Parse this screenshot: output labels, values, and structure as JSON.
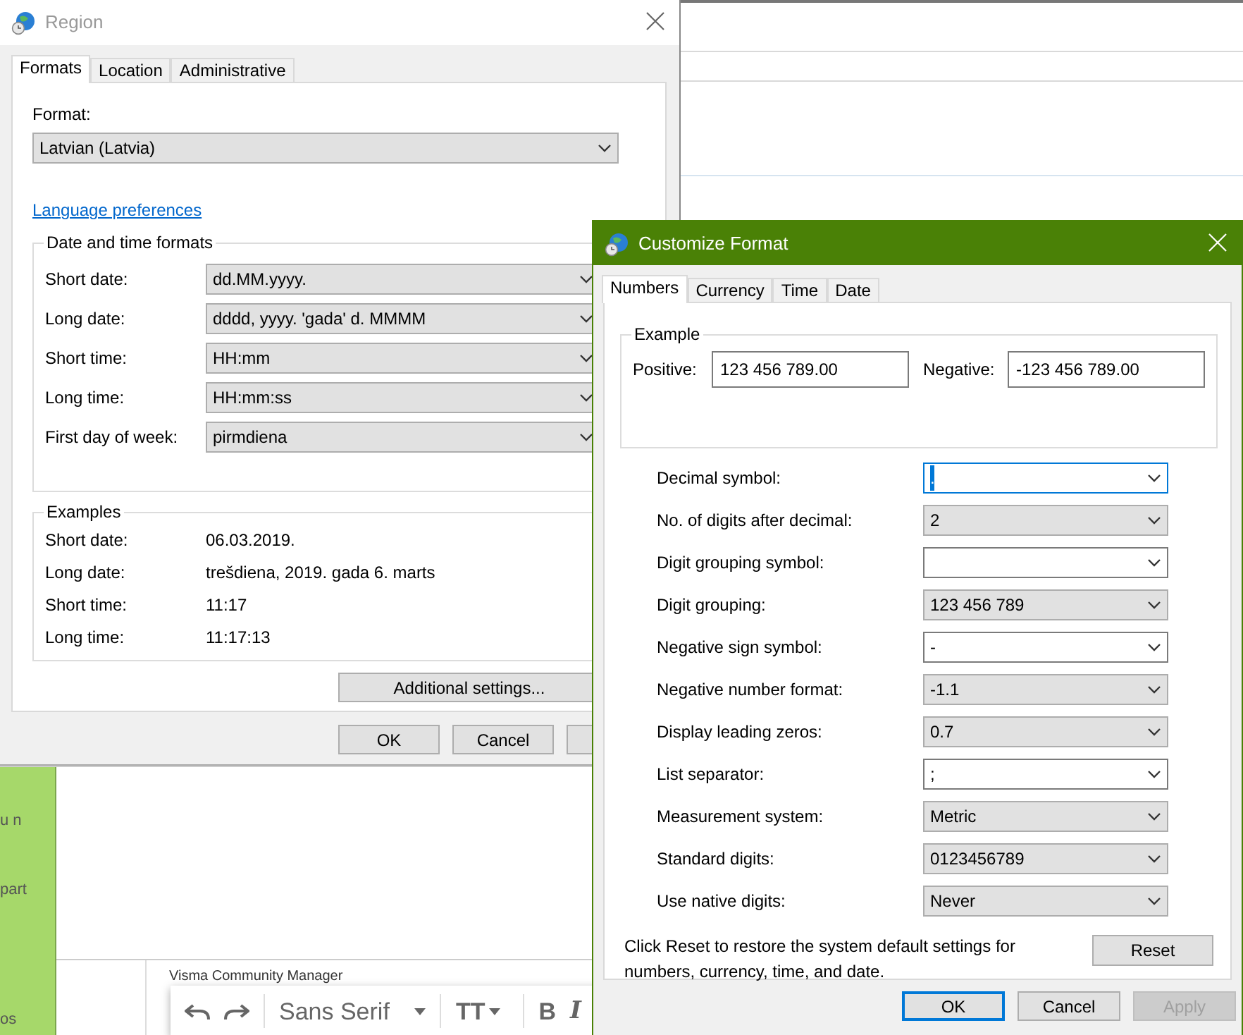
{
  "background": {
    "sidebar_fragments": [
      "u n",
      "part",
      "os"
    ],
    "signature": "Visma Community Manager",
    "toolbar": {
      "font_name": "Sans Serif",
      "buttons": [
        {
          "kind": "size",
          "label": "TT"
        },
        {
          "kind": "bold",
          "label": "B"
        },
        {
          "kind": "italic",
          "label": "I"
        }
      ]
    }
  },
  "region_window": {
    "title": "Region",
    "active": false,
    "tabs": [
      {
        "label": "Formats",
        "selected": true
      },
      {
        "label": "Location",
        "selected": false
      },
      {
        "label": "Administrative",
        "selected": false
      }
    ],
    "format_label": "Format:",
    "format_value": "Latvian (Latvia)",
    "link": "Language preferences",
    "formats_group": {
      "title": "Date and time formats",
      "rows": [
        {
          "label": "Short date:",
          "value": "dd.MM.yyyy."
        },
        {
          "label": "Long date:",
          "value": "dddd, yyyy. 'gada' d. MMMM"
        },
        {
          "label": "Short time:",
          "value": "HH:mm"
        },
        {
          "label": "Long time:",
          "value": "HH:mm:ss"
        },
        {
          "label": "First day of week:",
          "value": "pirmdiena"
        }
      ]
    },
    "examples_group": {
      "title": "Examples",
      "rows": [
        {
          "label": "Short date:",
          "value": "06.03.2019."
        },
        {
          "label": "Long date:",
          "value": "trešdiena, 2019. gada 6. marts"
        },
        {
          "label": "Short time:",
          "value": "11:17"
        },
        {
          "label": "Long time:",
          "value": "11:17:13"
        }
      ]
    },
    "additional_button": "Additional settings...",
    "buttons": [
      "OK",
      "Cancel"
    ]
  },
  "customize_window": {
    "title": "Customize Format",
    "active": true,
    "tabs": [
      {
        "label": "Numbers",
        "selected": true
      },
      {
        "label": "Currency",
        "selected": false
      },
      {
        "label": "Time",
        "selected": false
      },
      {
        "label": "Date",
        "selected": false
      }
    ],
    "example": {
      "title": "Example",
      "positive_label": "Positive:",
      "positive_value": "123 456 789.00",
      "negative_label": "Negative:",
      "negative_value": "-123 456 789.00"
    },
    "settings": [
      {
        "label": "Decimal symbol:",
        "value": ".",
        "kind": "edit",
        "focused": true
      },
      {
        "label": "No. of digits after decimal:",
        "value": "2",
        "kind": "list",
        "focused": false
      },
      {
        "label": "Digit grouping symbol:",
        "kind": "edit",
        "focused": false
      },
      {
        "label": "Digit grouping:",
        "value": "123 456 789",
        "kind": "list",
        "focused": false
      },
      {
        "label": "Negative sign symbol:",
        "value": "-",
        "kind": "edit",
        "focused": false
      },
      {
        "label": "Negative number format:",
        "value": "-1.1",
        "kind": "list",
        "focused": false
      },
      {
        "label": "Display leading zeros:",
        "value": "0.7",
        "kind": "list",
        "focused": false
      },
      {
        "label": "List separator:",
        "value": ";",
        "kind": "edit",
        "focused": false
      },
      {
        "label": "Measurement system:",
        "value": "Metric",
        "kind": "list",
        "focused": false
      },
      {
        "label": "Standard digits:",
        "value": "0123456789",
        "kind": "list",
        "focused": false
      },
      {
        "label": "Use native digits:",
        "value": "Never",
        "kind": "list",
        "focused": false
      }
    ],
    "note": "Click Reset to restore the system default settings for numbers, currency, time, and date.",
    "reset_button": "Reset",
    "buttons": [
      {
        "label": "OK",
        "default": true,
        "disabled": false
      },
      {
        "label": "Cancel",
        "default": false,
        "disabled": false
      },
      {
        "label": "Apply",
        "default": false,
        "disabled": true
      }
    ]
  }
}
